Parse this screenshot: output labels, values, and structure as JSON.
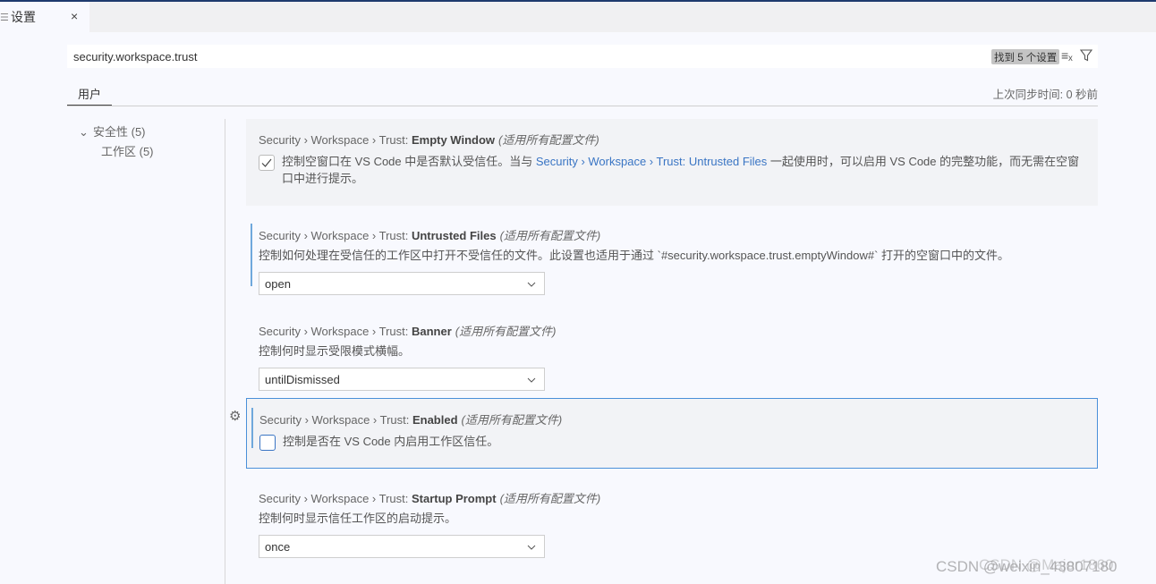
{
  "tab": {
    "icon": "settings-list-icon",
    "label": "设置",
    "close": "×"
  },
  "search": {
    "value": "security.workspace.trust",
    "result_badge": "找到 5 个设置"
  },
  "scope": {
    "tab": "用户",
    "sync_status": "上次同步时间: 0 秒前"
  },
  "tree": [
    {
      "label": "安全性 (5)"
    },
    {
      "label": "工作区 (5)"
    }
  ],
  "settings": [
    {
      "prefix": "Security › Workspace › Trust: ",
      "name": "Empty Window",
      "scope": "(适用所有配置文件)",
      "type": "checkbox",
      "checked": true,
      "desc_pre": "控制空窗口在 VS Code 中是否默认受信任。当与 ",
      "link": "Security › Workspace › Trust: Untrusted Files",
      "desc_post": " 一起使用时，可以启用 VS Code 的完整功能，而无需在空窗口中进行提示。"
    },
    {
      "prefix": "Security › Workspace › Trust: ",
      "name": "Untrusted Files",
      "scope": "(适用所有配置文件)",
      "type": "select",
      "desc": "控制如何处理在受信任的工作区中打开不受信任的文件。此设置也适用于通过 `#security.workspace.trust.emptyWindow#` 打开的空窗口中的文件。",
      "value": "open"
    },
    {
      "prefix": "Security › Workspace › Trust: ",
      "name": "Banner",
      "scope": "(适用所有配置文件)",
      "type": "select",
      "desc": "控制何时显示受限模式横幅。",
      "value": "untilDismissed"
    },
    {
      "prefix": "Security › Workspace › Trust: ",
      "name": "Enabled",
      "scope": "(适用所有配置文件)",
      "type": "checkbox",
      "checked": false,
      "desc": "控制是否在 VS Code 内启用工作区信任。"
    },
    {
      "prefix": "Security › Workspace › Trust: ",
      "name": "Startup Prompt",
      "scope": "(适用所有配置文件)",
      "type": "select",
      "desc": "控制何时显示信任工作区的启动提示。",
      "value": "once"
    }
  ],
  "watermark": [
    "CSDN @weixin_43807180",
    "CSDN @Major1860"
  ],
  "colors": {
    "accent": "#3a75c4",
    "focus_border": "#4a90d9",
    "modified_bar": "#6fa8dc"
  }
}
